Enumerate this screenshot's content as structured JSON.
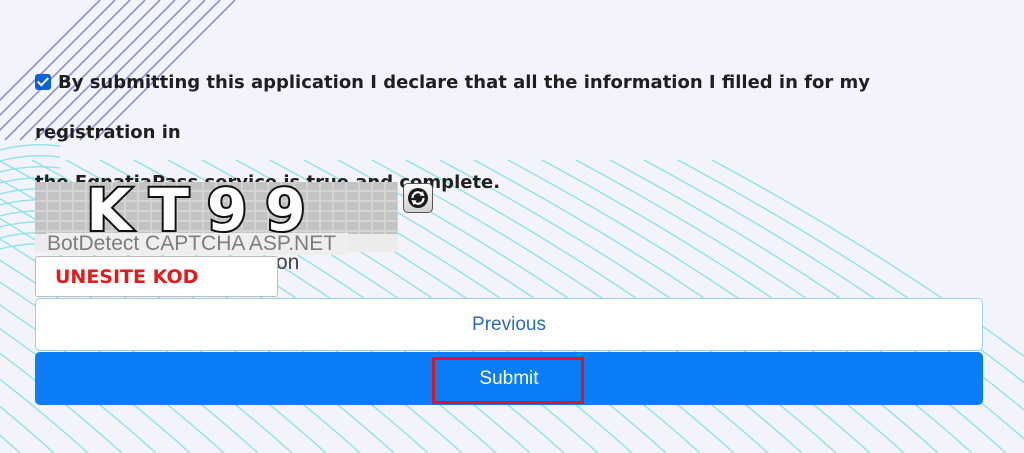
{
  "declaration": {
    "checked": true,
    "text_line1": "By submitting this application I declare that all the information I filled in for my registration in",
    "text_line2": "the EgnatiaPass service is true and complete."
  },
  "captcha": {
    "code": "KT99",
    "footer": "BotDetect CAPTCHA ASP.NET",
    "reload_icon": "reload-icon",
    "audio_fragment": "on"
  },
  "code_input": {
    "placeholder": "UNESITE KOD",
    "value": ""
  },
  "buttons": {
    "previous_label": "Previous",
    "submit_label": "Submit"
  },
  "colors": {
    "accent": "#0a7df7",
    "highlight": "#e3141e",
    "background": "#f3f3fb"
  }
}
